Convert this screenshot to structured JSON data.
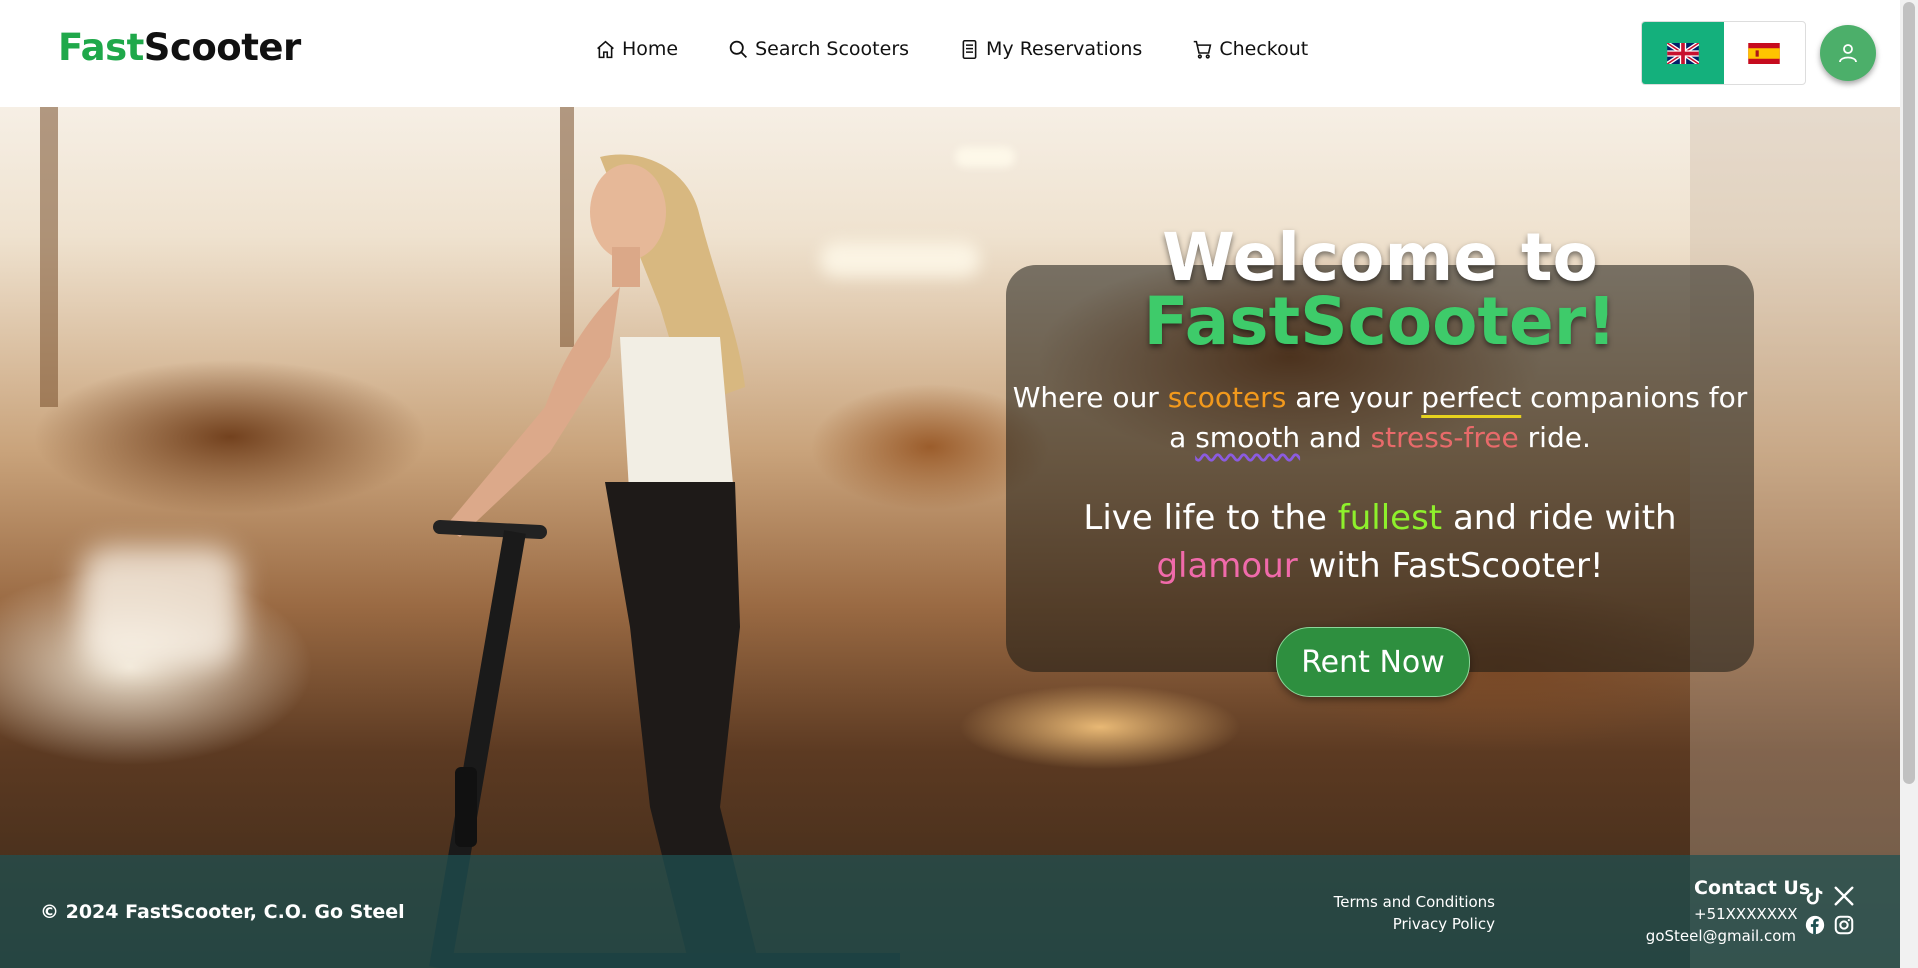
{
  "brand": {
    "part1": "Fast",
    "part2": "Scooter"
  },
  "nav": [
    {
      "label": "Home",
      "icon": "home-icon"
    },
    {
      "label": "Search Scooters",
      "icon": "search-icon"
    },
    {
      "label": "My Reservations",
      "icon": "document-icon"
    },
    {
      "label": "Checkout",
      "icon": "cart-icon"
    }
  ],
  "languages": [
    {
      "code": "en",
      "flag": "uk-flag-icon",
      "active": true
    },
    {
      "code": "es",
      "flag": "spain-flag-icon",
      "active": false
    }
  ],
  "hero": {
    "title_line1": "Welcome to",
    "title_line2": "FastScooter!",
    "tagline": {
      "t1": "Where our ",
      "scooters": "scooters",
      "t2": " are your ",
      "perfect": "perfect",
      "t3": " companions for a ",
      "smooth": "smooth",
      "t4": " and ",
      "stressfree": "stress-free",
      "t5": " ride."
    },
    "motto": {
      "t1": "Live life to the ",
      "fullest": "fullest",
      "t2": " and ride with ",
      "glamour": "glamour",
      "t3": " with FastScooter!"
    },
    "cta": "Rent Now"
  },
  "footer": {
    "copyright": "© 2024 FastScooter, C.O. Go Steel",
    "terms": "Terms and Conditions",
    "privacy": "Privacy Policy",
    "contact_title": "Contact Us",
    "phone": "+51XXXXXXX",
    "email": "goSteel@gmail.com",
    "social": [
      "tiktok-icon",
      "x-icon",
      "facebook-icon",
      "instagram-icon"
    ]
  },
  "colors": {
    "brand_green": "#1fa84a",
    "accent_teal": "#14b07c",
    "cta_green": "#2e8f3f",
    "footer_bg": "#1e5052"
  }
}
